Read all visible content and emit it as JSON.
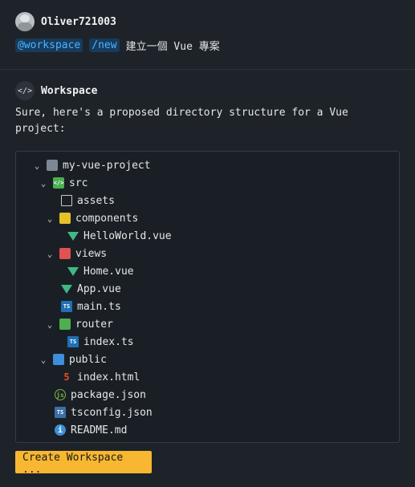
{
  "user": {
    "name": "Oliver721003",
    "avatar": "avatar-icon"
  },
  "prompt": {
    "chip_workspace": "@workspace",
    "chip_new": "/new",
    "text": "建立一個 Vue 專案"
  },
  "assistant": {
    "name": "Workspace",
    "avatar_icon": "code-icon",
    "reply": "Sure, here's a proposed directory structure for a Vue project:"
  },
  "tree": [
    {
      "label": "my-vue-project",
      "type": "folder",
      "icon": "folder-icon",
      "expanded": true
    },
    {
      "label": "src",
      "type": "folder",
      "icon": "src-folder-icon",
      "expanded": true
    },
    {
      "label": "assets",
      "type": "file",
      "icon": "file-icon"
    },
    {
      "label": "components",
      "type": "folder",
      "icon": "components-folder-icon",
      "expanded": true
    },
    {
      "label": "HelloWorld.vue",
      "type": "file",
      "icon": "vue-icon"
    },
    {
      "label": "views",
      "type": "folder",
      "icon": "views-folder-icon",
      "expanded": true
    },
    {
      "label": "Home.vue",
      "type": "file",
      "icon": "vue-icon"
    },
    {
      "label": "App.vue",
      "type": "file",
      "icon": "vue-icon"
    },
    {
      "label": "main.ts",
      "type": "file",
      "icon": "typescript-icon"
    },
    {
      "label": "router",
      "type": "folder",
      "icon": "router-folder-icon",
      "expanded": true
    },
    {
      "label": "index.ts",
      "type": "file",
      "icon": "typescript-icon"
    },
    {
      "label": "public",
      "type": "folder",
      "icon": "public-folder-icon",
      "expanded": true
    },
    {
      "label": "index.html",
      "type": "file",
      "icon": "html-icon"
    },
    {
      "label": "package.json",
      "type": "file",
      "icon": "json-icon"
    },
    {
      "label": "tsconfig.json",
      "type": "file",
      "icon": "tsconfig-icon"
    },
    {
      "label": "README.md",
      "type": "file",
      "icon": "info-icon"
    }
  ],
  "actions": {
    "create_label": "Create Workspace ..."
  },
  "colors": {
    "background": "#1e2329",
    "chip_bg": "#173b5c",
    "chip_text": "#4fb3ff",
    "button": "#f7b731",
    "vue_green": "#41b883"
  }
}
